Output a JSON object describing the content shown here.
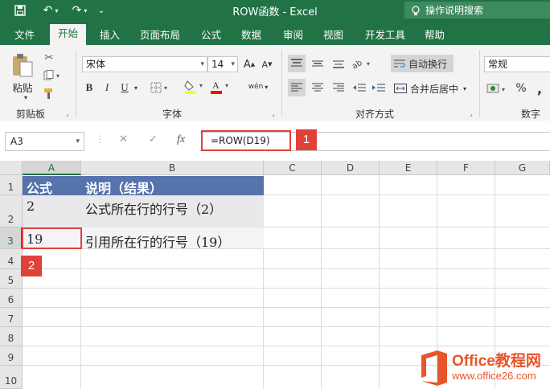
{
  "window": {
    "title": "ROW函数  -  Excel",
    "tell_me": "操作说明搜索"
  },
  "ribbon_tabs": [
    "文件",
    "开始",
    "插入",
    "页面布局",
    "公式",
    "数据",
    "审阅",
    "视图",
    "开发工具",
    "帮助"
  ],
  "ribbon": {
    "clipboard": {
      "paste_label": "粘贴",
      "group_label": "剪贴板"
    },
    "font": {
      "name": "宋体",
      "size": "14",
      "bold": "B",
      "italic": "I",
      "underline": "U",
      "inc_size": "A",
      "dec_size": "A",
      "font_color_letter": "A",
      "phonetic": "wén",
      "group_label": "字体"
    },
    "alignment": {
      "wrap_label": "自动换行",
      "merge_label": "合并后居中",
      "group_label": "对齐方式"
    },
    "number": {
      "format": "常规",
      "percent": "%",
      "comma": ",",
      "group_label": "数字"
    }
  },
  "formula_bar": {
    "name_box": "A3",
    "formula": "=ROW(D19)",
    "cancel": "✕",
    "enter": "✓",
    "fx": "fx"
  },
  "callouts": [
    "1",
    "2"
  ],
  "grid": {
    "columns": [
      "A",
      "B",
      "C",
      "D",
      "E",
      "F",
      "G"
    ],
    "rows": [
      "1",
      "2",
      "3",
      "4",
      "5",
      "6",
      "7",
      "8",
      "9",
      "10"
    ],
    "cells": {
      "a1": "公式",
      "b1": "说明（结果）",
      "a2": "2",
      "b2": "公式所在行的行号（2）",
      "a3": "19",
      "b3": "引用所在行的行号（19）"
    },
    "header_fill": "#5673ac",
    "accent": "#217346",
    "highlight": "#e0413a"
  },
  "watermark": {
    "brand": "Office教程网",
    "url": "www.office26.com"
  }
}
